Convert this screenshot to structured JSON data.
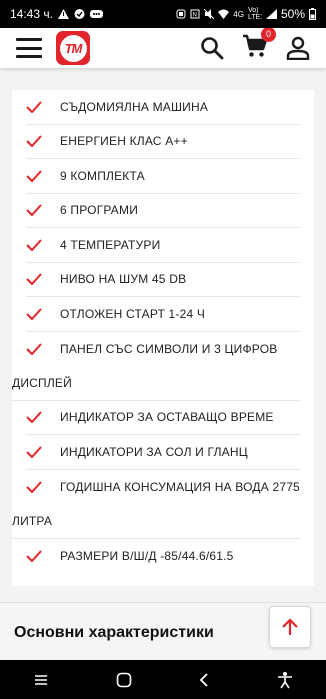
{
  "status_bar": {
    "time": "14:43 ч.",
    "network": "4G",
    "carrier": "Vo) LTE1",
    "battery": "50%"
  },
  "header": {
    "logo_text": "TM",
    "cart_count": "0",
    "accent": "#e2242b"
  },
  "features": [
    {
      "text": "СЪДОМИЯЛНА МАШИНА"
    },
    {
      "text": "ЕНЕРГИЕН КЛАС А++"
    },
    {
      "text": "9 КОМПЛЕКТА"
    },
    {
      "text": "6 ПРОГРАМИ"
    },
    {
      "text": "4 ТЕМПЕРАТУРИ"
    },
    {
      "text": "НИВО НА ШУМ 45 DB"
    },
    {
      "text": "ОТЛОЖЕН СТАРТ 1-24 Ч"
    },
    {
      "text": "ПАНЕЛ СЪС СИМВОЛИ И 3 ЦИФРОВ",
      "continuation": "ДИСПЛЕЙ"
    },
    {
      "text": "ИНДИКАТОР ЗА ОСТАВАЩО ВРЕМЕ"
    },
    {
      "text": "ИНДИКАТОРИ ЗА СОЛ И ГЛАНЦ"
    },
    {
      "text": "ГОДИШНА КОНСУМАЦИЯ НА ВОДА 2775",
      "continuation": "ЛИТРА"
    },
    {
      "text": "РАЗМЕРИ В/Ш/Д -85/44.6/61.5"
    }
  ],
  "section": {
    "title": "Основни характеристики"
  }
}
